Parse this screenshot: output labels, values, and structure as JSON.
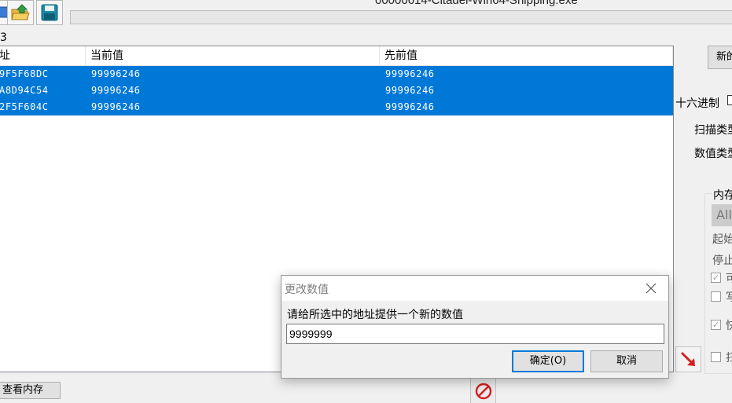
{
  "window": {
    "title": "00000614-Citadel-Win64-Shipping.exe"
  },
  "toolbar": {
    "icons": [
      "open-process-icon",
      "open-folder-icon",
      "save-icon"
    ]
  },
  "scan": {
    "found_count": "3",
    "columns": [
      "址",
      "当前值",
      "先前值"
    ],
    "rows": [
      {
        "address": "9F5F68DC",
        "current": "99996246",
        "previous": "99996246"
      },
      {
        "address": "A8D94C54",
        "current": "99996246",
        "previous": "99996246"
      },
      {
        "address": "2F5F604C",
        "current": "99996246",
        "previous": "99996246"
      }
    ],
    "selected_color": "#0078d7"
  },
  "right_panel": {
    "new_scan_label": "新的",
    "hex_label": "十六进制",
    "scan_type_label": "扫描类型",
    "value_type_label": "数值类型",
    "memory_group_label": "内存",
    "memory_region_value": "All",
    "start_label": "起始",
    "stop_label": "停止",
    "option_labels": [
      "可",
      "写",
      "快",
      "扫"
    ]
  },
  "bottom": {
    "view_memory_label": "查看内存"
  },
  "dialog": {
    "title": "更改数值",
    "prompt": "请给所选中的地址提供一个新的数值",
    "input_value": "9999999",
    "ok_label": "确定(O)",
    "cancel_label": "取消",
    "accent_color": "#0078d7"
  }
}
